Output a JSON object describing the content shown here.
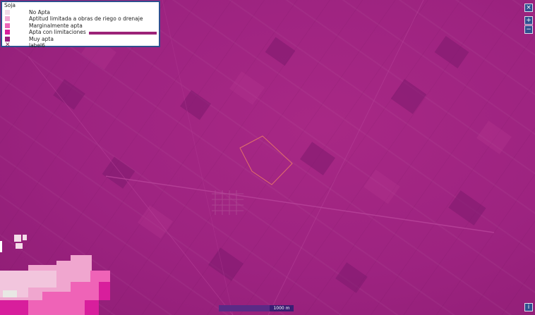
{
  "legend": {
    "title": "Soja",
    "items": [
      {
        "label": "No Apta",
        "color": "#f2dbe8",
        "icon": "square"
      },
      {
        "label": "Aptitud limitada a obras de riego o drenaje",
        "color": "#f3a8d4",
        "icon": "square"
      },
      {
        "label": "Marginalmente apta",
        "color": "#ef63b7",
        "icon": "square"
      },
      {
        "label": "Apta con limitaciones",
        "color": "#d81e9c",
        "icon": "square"
      },
      {
        "label": "Muy apta",
        "color": "#9d1f7e",
        "icon": "square"
      },
      {
        "label": "label6",
        "color": "#7a3050",
        "icon": "cross-icon"
      }
    ],
    "line_color": "#9b2378"
  },
  "controls": {
    "close_label": "×",
    "zoom_in_label": "+",
    "zoom_out_label": "−",
    "info_label": "i"
  },
  "scale": {
    "label": "1000 m"
  },
  "colors": {
    "map_base": "#a0247f",
    "outline": "#e0706a",
    "ui_blue": "#2f4f8f"
  }
}
